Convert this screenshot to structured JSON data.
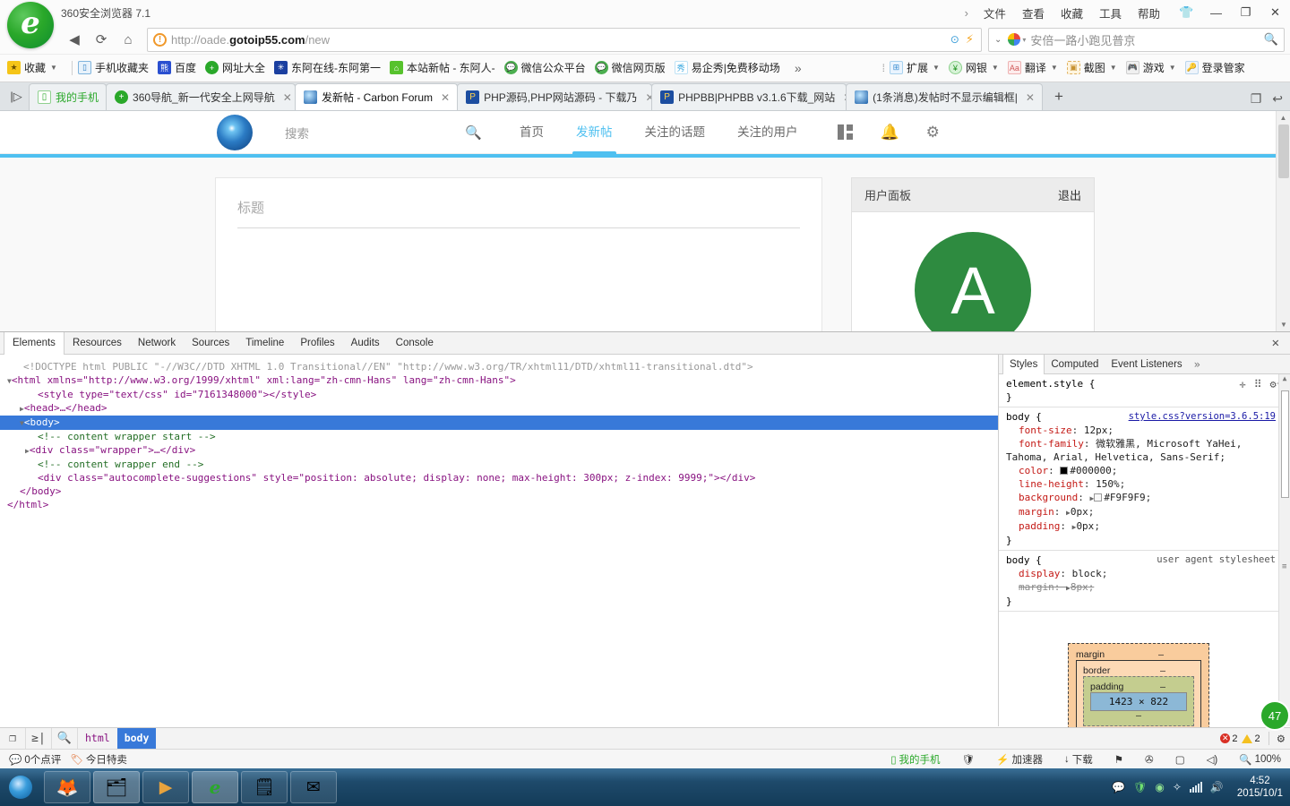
{
  "browser": {
    "app_title": "360安全浏览器 7.1",
    "menus": [
      "文件",
      "查看",
      "收藏",
      "工具",
      "帮助"
    ],
    "window_buttons": [
      "shirt-icon",
      "minimize-icon",
      "maximize-icon",
      "close-icon"
    ],
    "nav": {
      "back": "◀",
      "refresh": "⟳",
      "home": "⌂"
    },
    "url": {
      "scheme": "http://oade.",
      "host": "gotoip55.com",
      "path": "/new"
    },
    "search": {
      "value": "安倍一路小跑见普京",
      "placeholder": "搜索"
    },
    "bookmarks_left": [
      {
        "label": "收藏",
        "icon": "star-icon",
        "caret": true
      },
      {
        "label": "手机收藏夹",
        "icon": "phone-icon"
      },
      {
        "label": "百度",
        "icon": "baidu-icon"
      },
      {
        "label": "网址大全",
        "icon": "plus-circle-icon"
      },
      {
        "label": "东阿在线-东阿第一",
        "icon": "site-icon"
      },
      {
        "label": "本站新帖 - 东阿人-",
        "icon": "home-icon"
      },
      {
        "label": "微信公众平台",
        "icon": "wechat-icon"
      },
      {
        "label": "微信网页版",
        "icon": "wechat-icon"
      },
      {
        "label": "易企秀|免费移动场",
        "icon": "xiu-icon"
      }
    ],
    "bookmarks_overflow": "»",
    "toolbar_right": [
      {
        "label": "扩展",
        "icon": "extension-icon",
        "caret": true
      },
      {
        "label": "网银",
        "icon": "shield-icon",
        "caret": true
      },
      {
        "label": "翻译",
        "icon": "translate-icon",
        "caret": true
      },
      {
        "label": "截图",
        "icon": "screenshot-icon",
        "caret": true
      },
      {
        "label": "游戏",
        "icon": "gamepad-icon",
        "caret": true
      },
      {
        "label": "登录管家",
        "icon": "key-icon",
        "caret": false
      }
    ],
    "tabs": [
      {
        "label": "我的手机",
        "icon": "phone-icon",
        "active": false,
        "closable": false
      },
      {
        "label": "360导航_新一代安全上网导航",
        "icon": "nav360-icon",
        "active": false,
        "closable": true
      },
      {
        "label": "发新帖 - Carbon Forum",
        "icon": "forum-icon",
        "active": true,
        "closable": true
      },
      {
        "label": "PHP源码,PHP网站源码 - 下载乃",
        "icon": "php-icon",
        "active": false,
        "closable": true
      },
      {
        "label": "PHPBB|PHPBB v3.1.6下载_网站",
        "icon": "php-icon",
        "active": false,
        "closable": true
      },
      {
        "label": "(1条消息)发帖时不显示编辑框|",
        "icon": "forum-icon",
        "active": false,
        "closable": true
      }
    ],
    "new_tab": "+"
  },
  "page": {
    "search_placeholder": "搜索",
    "nav": [
      {
        "label": "首页",
        "active": false
      },
      {
        "label": "发新帖",
        "active": true
      },
      {
        "label": "关注的话题",
        "active": false
      },
      {
        "label": "关注的用户",
        "active": false
      }
    ],
    "nav_icons": [
      "grid-icon",
      "bell-icon",
      "gear-icon"
    ],
    "compose": {
      "title_placeholder": "标题"
    },
    "user_panel": {
      "heading": "用户面板",
      "logout": "退出",
      "avatar_letter": "A"
    },
    "accent_color": "#4fc0f0"
  },
  "devtools": {
    "tabs": [
      "Elements",
      "Resources",
      "Network",
      "Sources",
      "Timeline",
      "Profiles",
      "Audits",
      "Console"
    ],
    "active_tab": "Elements",
    "close_label": "✕",
    "dom": [
      {
        "indent": 1,
        "type": "doctype",
        "text": "<!DOCTYPE html PUBLIC \"-//W3C//DTD XHTML 1.0 Transitional//EN\" \"http://www.w3.org/TR/xhtml11/DTD/xhtml11-transitional.dtd\">"
      },
      {
        "indent": 0,
        "type": "tag",
        "triangle": "▼",
        "text": "<html xmlns=\"http://www.w3.org/1999/xhtml\" xml:lang=\"zh-cmn-Hans\" lang=\"zh-cmn-Hans\">"
      },
      {
        "indent": 2,
        "type": "tag",
        "text": "<style type=\"text/css\" id=\"7161348000\"></style>"
      },
      {
        "indent": 1,
        "type": "tag",
        "triangle": "▶",
        "text": "<head>…</head>"
      },
      {
        "indent": 1,
        "type": "tag",
        "triangle": "▼",
        "text": "<body>",
        "selected": true
      },
      {
        "indent": 2,
        "type": "comment",
        "text": "<!-- content wrapper start -->"
      },
      {
        "indent": 1,
        "type": "tag",
        "triangle": "▶",
        "text": "<div class=\"wrapper\">…</div>"
      },
      {
        "indent": 2,
        "type": "comment",
        "text": "<!-- content wrapper end -->"
      },
      {
        "indent": 2,
        "type": "tag",
        "text": "<div class=\"autocomplete-suggestions\" style=\"position: absolute; display: none; max-height: 300px; z-index: 9999;\"></div>"
      },
      {
        "indent": 1,
        "type": "tag",
        "text": "</body>"
      },
      {
        "indent": 0,
        "type": "tag",
        "text": "</html>"
      }
    ],
    "styles": {
      "tabs": [
        "Styles",
        "Computed",
        "Event Listeners"
      ],
      "active_tab": "Styles",
      "more": "»",
      "toolbar_icons": [
        "add-rule-icon",
        "element-state-icon",
        "settings-icon"
      ],
      "rules": [
        {
          "selector": "element.style {",
          "source": "",
          "props": [],
          "close": "}"
        },
        {
          "selector": "body {",
          "source": "style.css?version=3.6.5:19",
          "props": [
            {
              "name": "font-size",
              "value": "12px"
            },
            {
              "name": "font-family",
              "value": "微软雅黑, Microsoft YaHei, Tahoma, Arial, Helvetica, Sans-Serif;"
            },
            {
              "name": "color",
              "value": "#000000",
              "swatch": "#000000"
            },
            {
              "name": "line-height",
              "value": "150%"
            },
            {
              "name": "background",
              "value": "#F9F9F9",
              "swatch": "#F9F9F9",
              "expand": true
            },
            {
              "name": "margin",
              "value": "0px",
              "expand": true
            },
            {
              "name": "padding",
              "value": "0px",
              "expand": true
            }
          ],
          "close": "}"
        },
        {
          "selector": "body {",
          "source": "user agent stylesheet",
          "props": [
            {
              "name": "display",
              "value": "block"
            },
            {
              "name": "margin",
              "value": "8px",
              "expand": true,
              "struck": true
            }
          ],
          "close": "}"
        }
      ],
      "box_model": {
        "margin_label": "margin",
        "margin_value": "–",
        "border_label": "border",
        "border_value": "–",
        "padding_label": "padding",
        "padding_value": "–",
        "content": "1423 × 822"
      }
    },
    "footer": {
      "buttons": [
        "inspect-icon",
        "dock-icon",
        "find-icon"
      ],
      "breadcrumb": [
        "html",
        "body"
      ],
      "selected_crumb": "body",
      "errors": "2",
      "warnings": "2",
      "settings_icon": "gear-icon"
    }
  },
  "statusbar": {
    "left": [
      {
        "label": "0个点评",
        "icon": "comment-icon"
      },
      {
        "label": "今日特卖",
        "icon": "tag-icon"
      }
    ],
    "right": [
      {
        "label": "我的手机",
        "icon": "phone-icon"
      },
      {
        "label": "",
        "icon": "shield-icon"
      },
      {
        "label": "加速器",
        "icon": "rocket-icon"
      },
      {
        "label": "下载",
        "icon": "download-icon"
      },
      {
        "label": "",
        "icon": "flag-icon"
      },
      {
        "label": "",
        "icon": "privacy-icon"
      },
      {
        "label": "",
        "icon": "window-icon"
      },
      {
        "label": "",
        "icon": "volume-icon"
      },
      {
        "label": "100%",
        "icon": "zoom-icon"
      }
    ]
  },
  "taskbar": {
    "start": "start-button",
    "apps": [
      "firefox-icon",
      "explorer-icon",
      "media-player-icon",
      "360-browser-icon",
      "notes-icon",
      "mail-icon"
    ],
    "tray_icons": [
      "messenger-icon",
      "shield-icon",
      "360-icon",
      "bluetooth-icon",
      "network-icon",
      "volume-icon"
    ],
    "clock_time": "4:52",
    "clock_date": "2015/10/1"
  },
  "float_badge": "47"
}
